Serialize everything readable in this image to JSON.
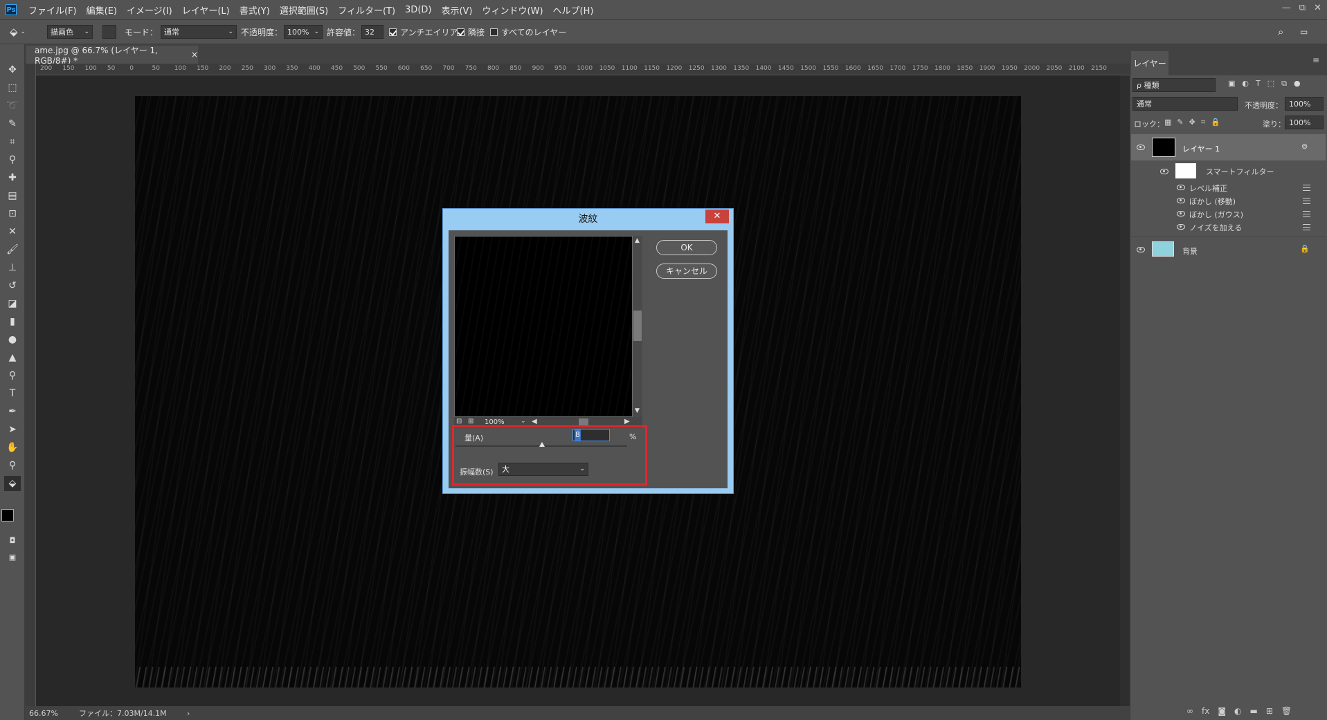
{
  "app": {
    "logo": "Ps"
  },
  "menu": [
    "ファイル(F)",
    "編集(E)",
    "イメージ(I)",
    "レイヤー(L)",
    "書式(Y)",
    "選択範囲(S)",
    "フィルター(T)",
    "3D(D)",
    "表示(V)",
    "ウィンドウ(W)",
    "ヘルプ(H)"
  ],
  "window_controls": {
    "minimize": "—",
    "restore": "⧉",
    "close": "✕"
  },
  "options": {
    "fill_source": "描画色",
    "mode_label": "モード：",
    "mode_value": "通常",
    "opacity_label": "不透明度：",
    "opacity_value": "100%",
    "tolerance_label": "許容値：",
    "tolerance_value": "32",
    "antialias_label": "アンチエイリアス",
    "antialias_checked": true,
    "contiguous_label": "隣接",
    "contiguous_checked": true,
    "all_layers_label": "すべてのレイヤー",
    "all_layers_checked": false
  },
  "document": {
    "tab_title": "ame.jpg @ 66.7% (レイヤー 1, RGB/8#) *",
    "tab_close": "×",
    "ruler_ticks": [
      "200",
      "150",
      "100",
      "50",
      "0",
      "50",
      "100",
      "150",
      "200",
      "250",
      "300",
      "350",
      "400",
      "450",
      "500",
      "550",
      "600",
      "650",
      "700",
      "750",
      "800",
      "850",
      "900",
      "950",
      "1000",
      "1050",
      "1100",
      "1150",
      "1200",
      "1250",
      "1300",
      "1350",
      "1400",
      "1450",
      "1500",
      "1550",
      "1600",
      "1650",
      "1700",
      "1750",
      "1800",
      "1850",
      "1900",
      "1950",
      "2000",
      "2050",
      "2100",
      "2150"
    ]
  },
  "status": {
    "zoom": "66.67%",
    "file_info": "ファイル：7.03M/14.1M",
    "arrow": "›"
  },
  "layers_panel": {
    "tab": "レイヤー",
    "filter_kind": "ρ 種類",
    "blend_mode": "通常",
    "opacity_label": "不透明度：",
    "opacity_value": "100%",
    "lock_label": "ロック：",
    "fill_label": "塗り：",
    "fill_value": "100%",
    "layers": [
      {
        "name": "レイヤー 1",
        "selected": true
      },
      {
        "name": "背景",
        "selected": false
      }
    ],
    "smart_filter_label": "スマートフィルター",
    "filters": [
      "レベル補正",
      "ぼかし (移動)",
      "ぼかし (ガウス)",
      "ノイズを加える"
    ]
  },
  "dialog": {
    "title": "波紋",
    "close": "✕",
    "ok": "OK",
    "cancel": "キャンセル",
    "zoom": "100%",
    "amount_label": "量(A)",
    "amount_value": "8",
    "amount_unit": "%",
    "size_label": "振幅数(S)",
    "size_value": "大"
  }
}
